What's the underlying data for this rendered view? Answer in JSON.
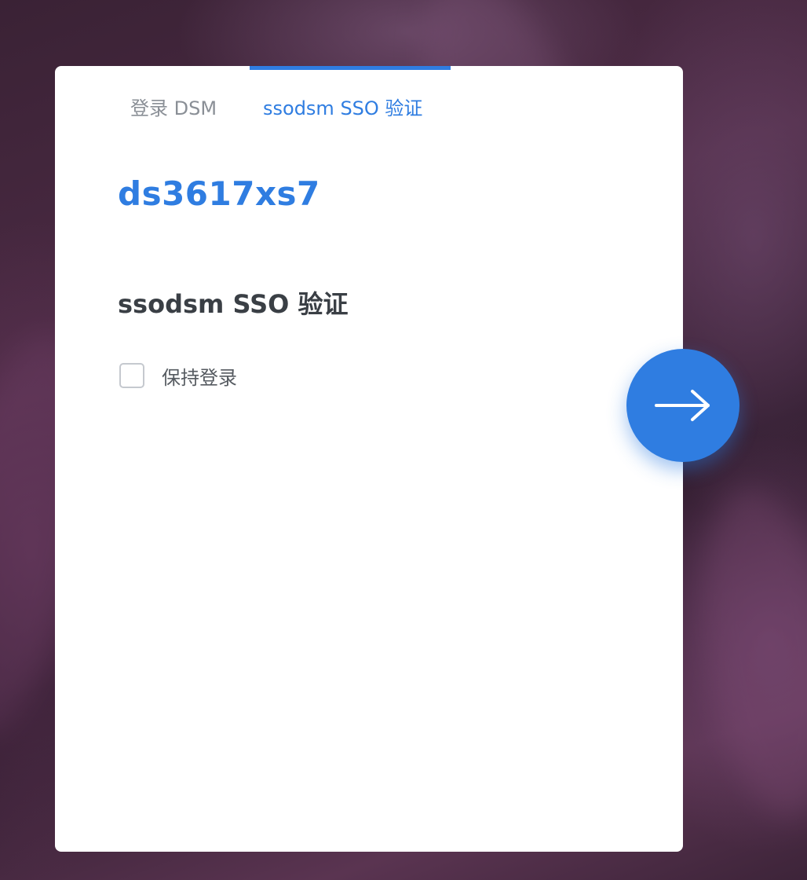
{
  "tabs": {
    "dsm_login": "登录 DSM",
    "sso_auth": "ssodsm SSO 验证"
  },
  "login": {
    "hostname": "ds3617xs7",
    "section_title": "ssodsm SSO 验证",
    "remember_me_label": "保持登录",
    "remember_me_checked": false
  },
  "icons": {
    "go_button_icon": "arrow-right-icon"
  },
  "colors": {
    "accent": "#2f7de1",
    "card_background": "#ffffff",
    "inactive_tab": "#8a8f96",
    "title_text": "#3a3f45"
  }
}
